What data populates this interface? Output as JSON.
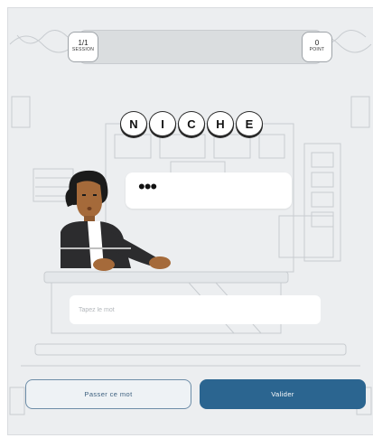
{
  "hud": {
    "session_value": "1/1",
    "session_label": "SESSION",
    "points_value": "0",
    "points_label": "POINT"
  },
  "word": {
    "letters": [
      "N",
      "I",
      "C",
      "H",
      "E"
    ]
  },
  "speech_bubble": {
    "text": "•••"
  },
  "input": {
    "placeholder": "Tapez le mot",
    "value": ""
  },
  "buttons": {
    "skip_label": "Passer ce mot",
    "validate_label": "Valider"
  },
  "colors": {
    "background": "#eceef0",
    "primary": "#2b6590",
    "secondary_border": "#6d8da8",
    "tile_border": "#2a2a2a"
  }
}
